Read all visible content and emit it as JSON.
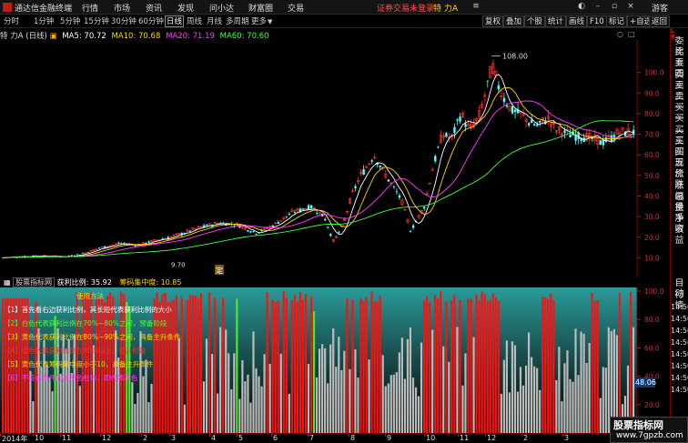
{
  "app": {
    "name": "通达信金融终端",
    "menus": [
      "行情",
      "市场",
      "资讯",
      "发现",
      "问小达",
      "财富圈",
      "交易"
    ],
    "notice": "证券交易未登录",
    "stock": "特 力A",
    "guest": "游客"
  },
  "toolbar": {
    "periods": [
      "分时",
      "1分钟",
      "5分钟",
      "15分钟",
      "30分钟",
      "60分钟",
      "日线",
      "周线",
      "月线",
      "多周期",
      "更多"
    ],
    "active": "日线",
    "right_buttons": [
      "复权",
      "叠加",
      "个股",
      "统计",
      "画线",
      "F10",
      "标记",
      "+自选",
      "返回"
    ]
  },
  "main": {
    "title": "特 力A",
    "period": "(日线)",
    "ma": [
      {
        "label": "MA5: 70.72",
        "color": "#ffffff"
      },
      {
        "label": "MA10: 70.68",
        "color": "#ffd700"
      },
      {
        "label": "MA20: 71.19",
        "color": "#ff40ff"
      },
      {
        "label": "MA60: 70.60",
        "color": "#40ff40"
      }
    ],
    "price_ticks": [
      "100.0",
      "90.0",
      "80.0",
      "70.0",
      "60.0",
      "50.0",
      "40.0",
      "30.0",
      "20.0",
      "10.0"
    ],
    "high_label": "108.00",
    "low_label": "9.70",
    "marker": "定",
    "price_range": [
      4,
      114
    ]
  },
  "sub": {
    "tab": "股票指标网",
    "hdr_label": "获利比例: 35.92",
    "hdr_label2": "筹码集中度: 10.85",
    "ticks": [
      "100.0",
      "80.0",
      "60.0",
      "40.0",
      "20.0"
    ],
    "current": "48.06",
    "legend": [
      {
        "text": "使用方法",
        "color": "#ffd700"
      },
      {
        "text": "【1】首先看右边获利比例，其长短代表获利比例的大小",
        "color": "#ffffff"
      },
      {
        "text": "【2】白色代表获利比例在70%~80%之间，预备阶段",
        "color": "#40ff40"
      },
      {
        "text": "【3】黄色代表获利比例在80%~90%之间，具备主升条件",
        "color": "#ffd700"
      },
      {
        "text": "【4】红色代表获利比例在90%以上，拉升阶段",
        "color": "#ff3030"
      },
      {
        "text": "【5】黄色代表筹码集中度小于10，具备主升条件",
        "color": "#ffd700"
      },
      {
        "text": "【6】不符合条件的是灰色柱体，即代表灰色",
        "color": "#ff40ff"
      }
    ]
  },
  "xaxis": [
    "2014年",
    "10",
    "11",
    "12",
    "2",
    "3",
    "4",
    "5",
    "6",
    "7",
    "8",
    "9",
    "10",
    "11",
    "12",
    "2",
    "3"
  ],
  "right_panel": {
    "top": [
      "L",
      "R",
      "委比",
      "卖五",
      "卖四",
      "卖三",
      "卖二",
      "卖一",
      "买一",
      "买二",
      "买三",
      "买四",
      "买五",
      "现价",
      "涨跌",
      "涨幅",
      "总量",
      "换手",
      "净资",
      "收益"
    ],
    "bottom": [
      "自动",
      "行情",
      "14:50",
      "14:50",
      "14:50",
      "14:50",
      "14:50",
      "14:50",
      "14:50",
      "14:50"
    ]
  },
  "watermark": {
    "line1": "股票指标网",
    "line2": "www.7gpzb.com"
  },
  "colors": {
    "up": "#ff3333",
    "down": "#54ffff",
    "bg": "#000000",
    "green_bar": "#44ee22",
    "red_bar": "#ff1010",
    "gray_bar": "#bbbbbb"
  }
}
